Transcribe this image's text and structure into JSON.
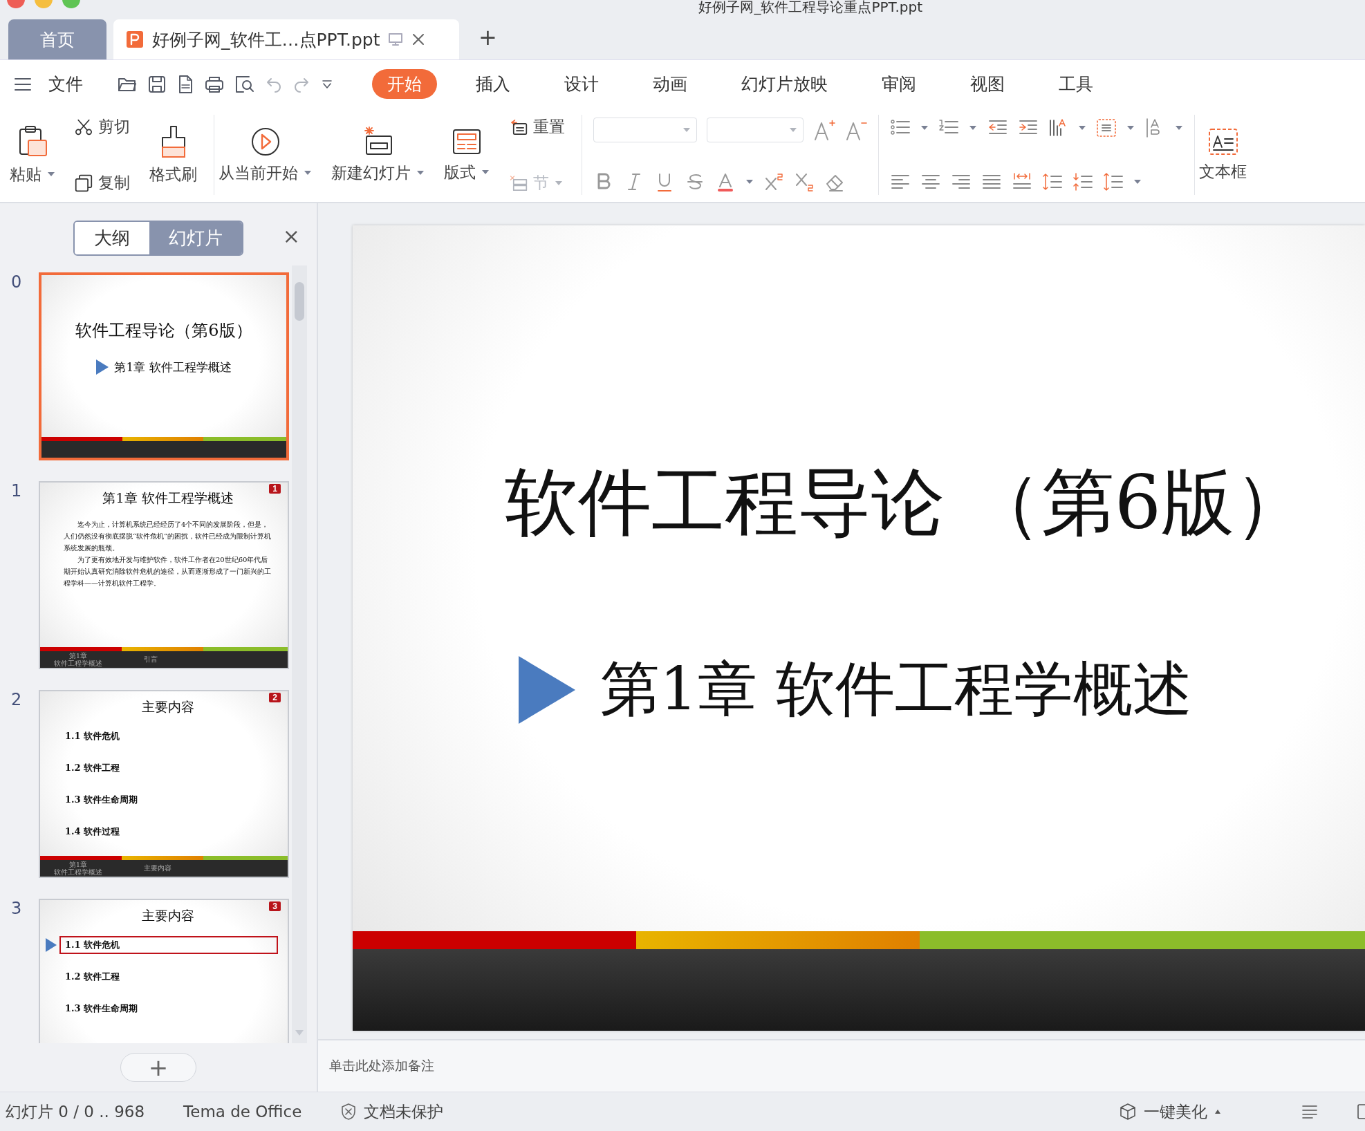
{
  "window": {
    "title": "好例子网_软件工程导论重点PPT.ppt"
  },
  "tabs": [
    {
      "label": "首页",
      "kind": "home",
      "selected": false
    },
    {
      "label": "好例子网_软件工…点PPT.ppt",
      "kind": "document",
      "selected": true
    }
  ],
  "new_tab": "+",
  "menu": {
    "file": "文件",
    "items": [
      {
        "label": "开始",
        "selected": true
      },
      {
        "label": "插入",
        "selected": false
      },
      {
        "label": "设计",
        "selected": false
      },
      {
        "label": "动画",
        "selected": false
      },
      {
        "label": "幻灯片放映",
        "selected": false
      },
      {
        "label": "审阅",
        "selected": false
      },
      {
        "label": "视图",
        "selected": false
      },
      {
        "label": "工具",
        "selected": false
      }
    ]
  },
  "ribbon": [
    {
      "kind": "buttons",
      "columns": [
        [
          {
            "kind": "paste",
            "label": "粘贴",
            "dropdown": true,
            "disabled": false
          }
        ],
        [
          {
            "kind": "cut",
            "label": "剪切",
            "dropdown": false,
            "disabled": false
          },
          {
            "kind": "copy",
            "label": "复制",
            "dropdown": false,
            "disabled": false
          }
        ],
        [
          {
            "kind": "brush",
            "label": "格式刷",
            "dropdown": false,
            "disabled": false
          }
        ]
      ]
    },
    {
      "kind": "buttons",
      "columns": [
        [
          {
            "kind": "play",
            "label": "从当前开始",
            "dropdown": true,
            "disabled": false
          }
        ],
        [
          {
            "kind": "newslide",
            "label": "新建幻灯片",
            "dropdown": true,
            "disabled": false
          }
        ],
        [
          {
            "kind": "layout",
            "label": "版式",
            "dropdown": true,
            "disabled": false
          }
        ],
        [
          {
            "kind": "reset",
            "label": "重置",
            "dropdown": false,
            "disabled": false
          },
          {
            "kind": "section",
            "label": "节",
            "dropdown": true,
            "disabled": true
          }
        ]
      ]
    },
    {
      "kind": "font"
    },
    {
      "kind": "paragraph"
    },
    {
      "kind": "buttons",
      "columns": [
        [
          {
            "kind": "textbox",
            "label": "文本框",
            "dropdown": false,
            "disabled": false
          }
        ]
      ]
    }
  ],
  "panel": {
    "views": [
      {
        "label": "大纲",
        "selected": false
      },
      {
        "label": "幻灯片",
        "selected": true
      }
    ],
    "close": "×",
    "add": "+",
    "slides": [
      {
        "number": "0",
        "selected": true,
        "kind": "title",
        "title": "软件工程导论（第6版）",
        "subtitle": "第1章  软件工程学概述"
      },
      {
        "number": "1",
        "selected": false,
        "kind": "text",
        "badge": "1",
        "title": "第1章 软件工程学概述",
        "paragraphs": [
          "迄今为止，计算机系统已经经历了4个不同的发展阶段，但是，人们仍然没有彻底摆脱“软件危机”的困扰，软件已经成为限制计算机系统发展的瓶颈。",
          "为了更有效地开发与维护软件，软件工作者在20世纪60年代后期开始认真研究消除软件危机的途径，从而逐渐形成了一门新兴的工程学科——计算机软件工程学。"
        ],
        "footer": [
          "第1章",
          "软件工程学概述"
        ],
        "footer_center": "引言"
      },
      {
        "number": "2",
        "selected": false,
        "kind": "list",
        "badge": "2",
        "title": "主要内容",
        "items": [
          {
            "text": "1.1 软件危机",
            "current": false
          },
          {
            "text": "1.2 软件工程",
            "current": false
          },
          {
            "text": "1.3 软件生命周期",
            "current": false
          },
          {
            "text": "1.4 软件过程",
            "current": false
          }
        ],
        "footer": [
          "第1章",
          "软件工程学概述"
        ],
        "footer_center": "主要内容"
      },
      {
        "number": "3",
        "selected": false,
        "kind": "list",
        "badge": "3",
        "title": "主要内容",
        "items": [
          {
            "text": "1.1 软件危机",
            "current": true
          },
          {
            "text": "1.2 软件工程",
            "current": false
          },
          {
            "text": "1.3 软件生命周期",
            "current": false
          }
        ]
      }
    ]
  },
  "slide": {
    "title": "软件工程导论 （第6版）",
    "subtitle": "第1章  软件工程学概述"
  },
  "notes": {
    "placeholder": "单击此处添加备注"
  },
  "status_bar": {
    "slide_info": "幻灯片 0 / 0 .. 968",
    "theme": "Tema de Office",
    "protection": "文档未保护",
    "beautify": "一键美化"
  }
}
